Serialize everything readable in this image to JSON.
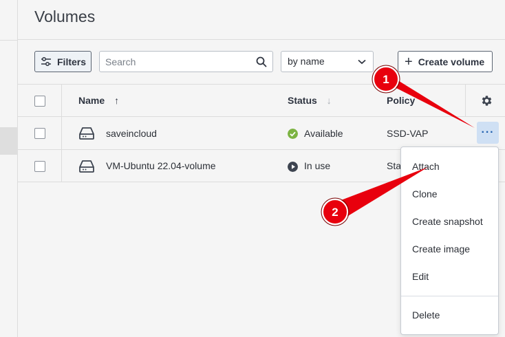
{
  "header": {
    "title": "Volumes"
  },
  "toolbar": {
    "filters_label": "Filters",
    "search_placeholder": "Search",
    "search_value": "",
    "sort_selected": "by name",
    "create_label": "Create volume"
  },
  "table": {
    "columns": [
      {
        "label": "Name",
        "sort": "up"
      },
      {
        "label": "Status",
        "sort": "down"
      },
      {
        "label": "Policy"
      }
    ],
    "rows": [
      {
        "name": "saveincloud",
        "status": "Available",
        "status_color": "#7cb342",
        "status_icon": "check-circle-icon",
        "policy": "SSD-VAP"
      },
      {
        "name": "VM-Ubuntu 22.04-volume",
        "status": "In use",
        "status_color": "#3d4450",
        "status_icon": "play-circle-icon",
        "policy": "Sta"
      }
    ]
  },
  "menu": {
    "items": [
      "Attach",
      "Clone",
      "Create snapshot",
      "Create image",
      "Edit",
      "Delete"
    ]
  },
  "annotations": [
    {
      "label": "1",
      "color": "#e8000d"
    },
    {
      "label": "2",
      "color": "#e8000d"
    }
  ],
  "colors": {
    "accent": "#cfe0f4",
    "available": "#7cb342",
    "callout": "#e8000d"
  }
}
